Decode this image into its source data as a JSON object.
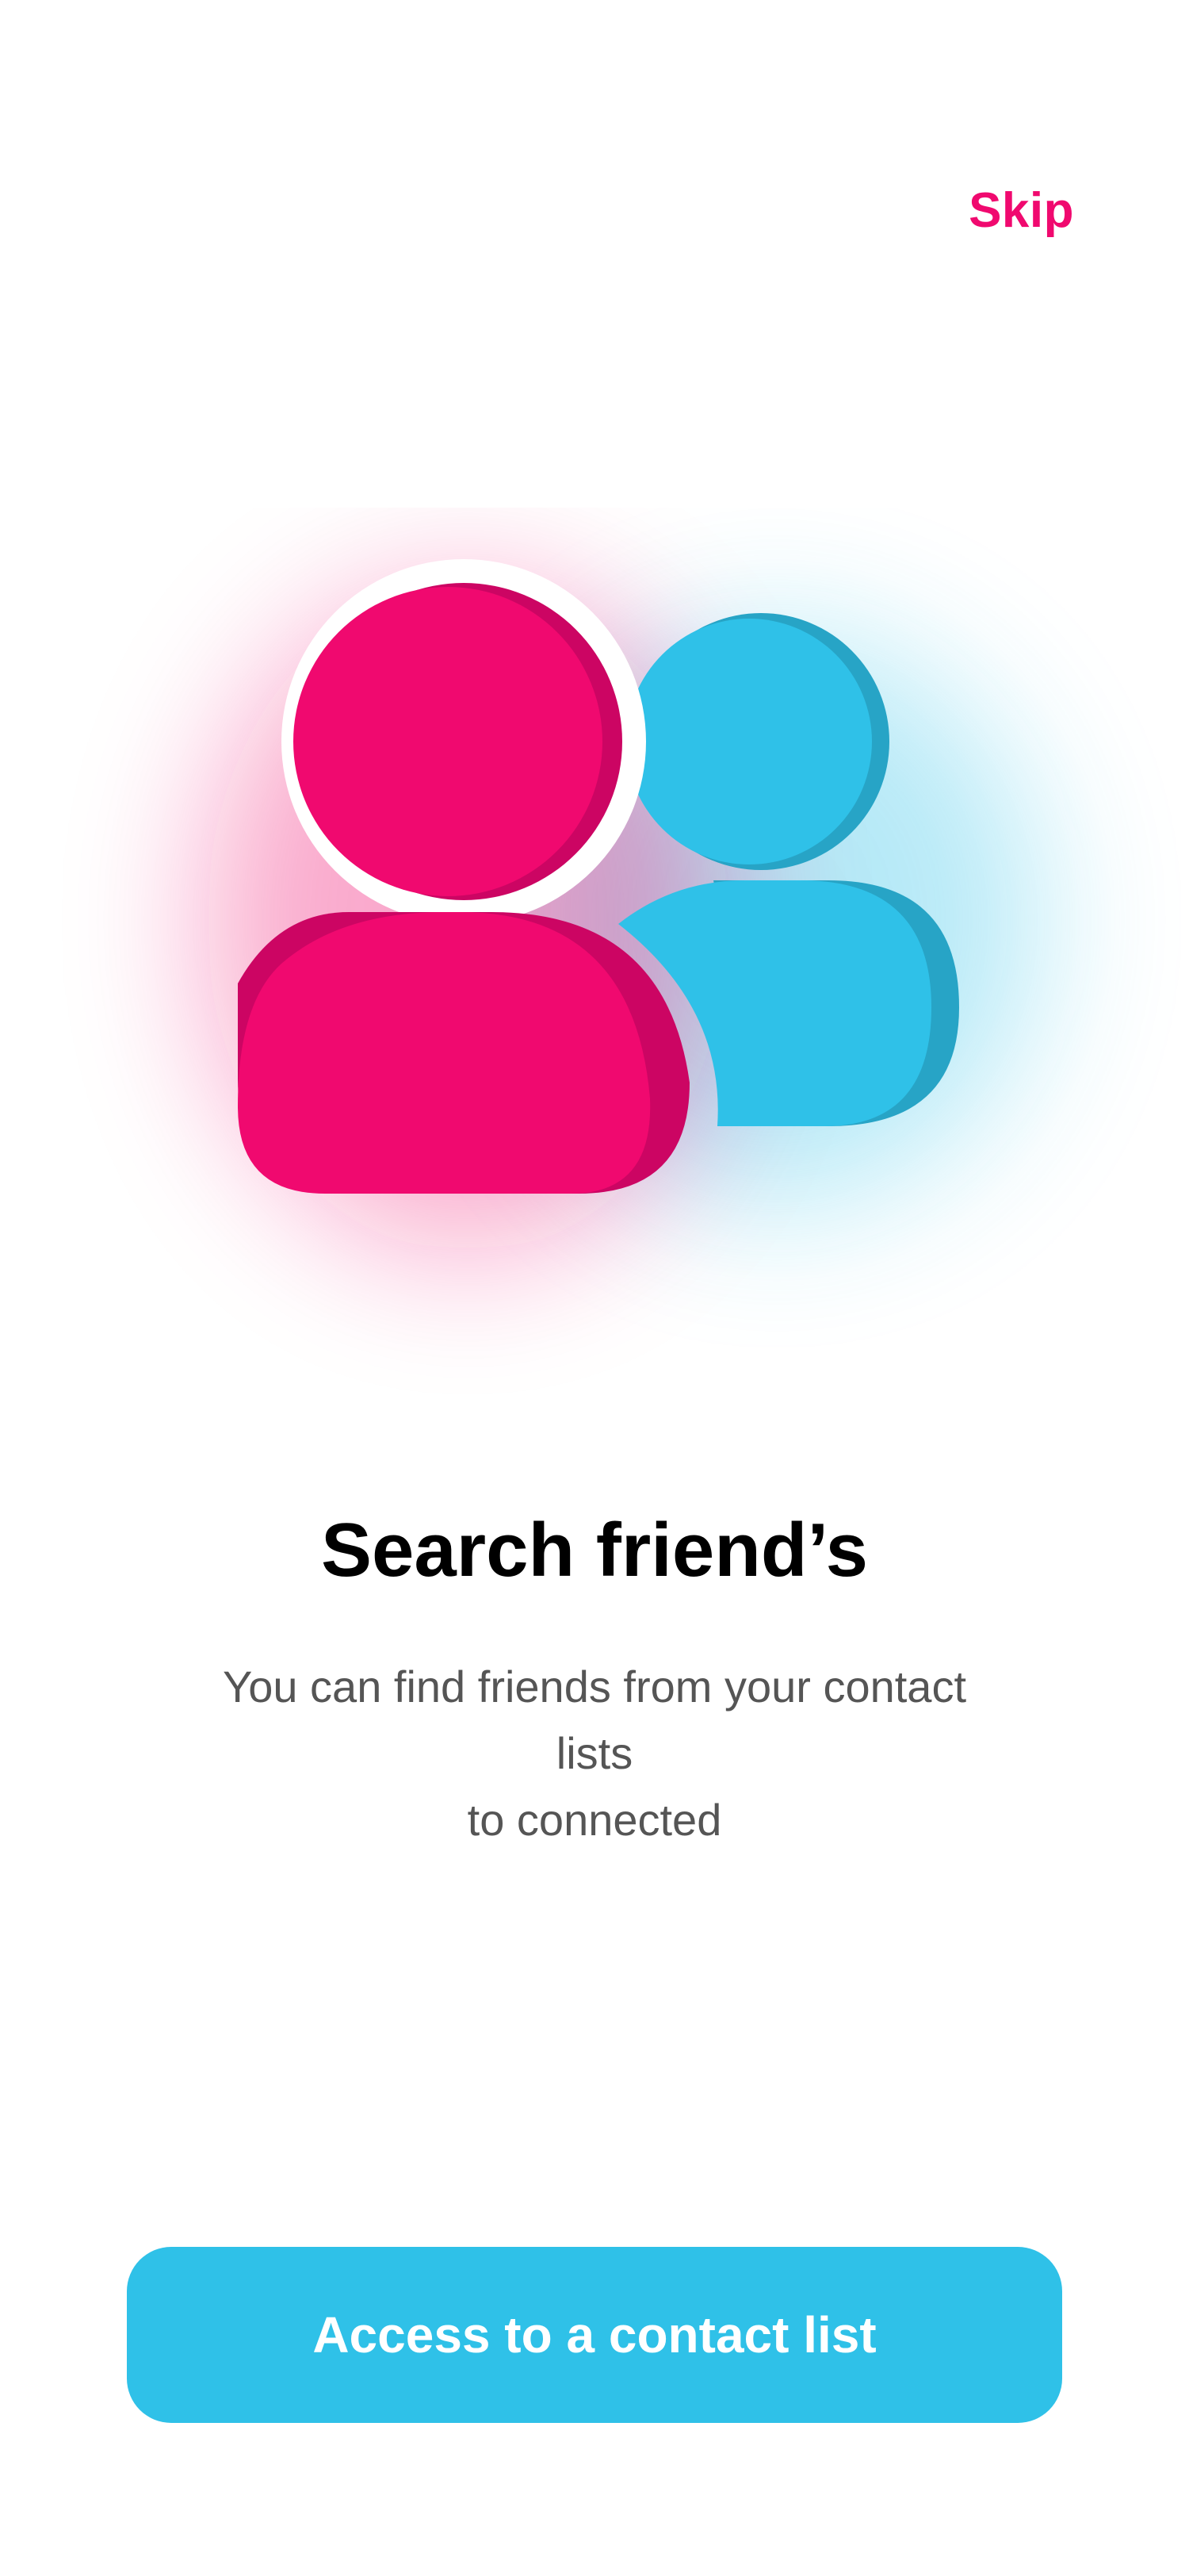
{
  "header": {
    "skip_label": "Skip"
  },
  "illustration": {
    "primary_color": "#F0096F",
    "primary_shade": "#CC0563",
    "secondary_color": "#2FC1E8",
    "secondary_shade": "#27A4C6"
  },
  "content": {
    "title": "Search friend’s",
    "subtitle_lines": [
      "You can find friends from your contact",
      "lists",
      "to connected"
    ]
  },
  "cta": {
    "label": "Access to a contact list",
    "color": "#2FC1E8"
  }
}
